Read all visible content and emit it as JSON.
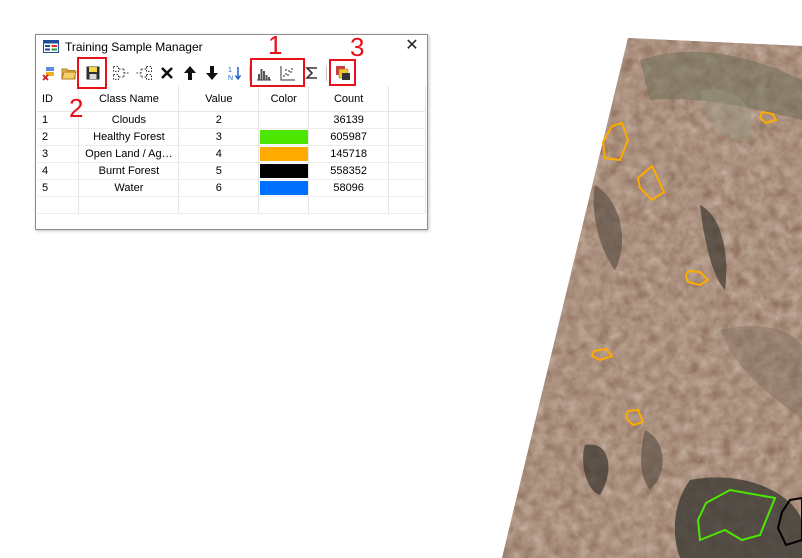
{
  "window": {
    "title": "Training Sample Manager",
    "close_glyph": "✕"
  },
  "toolbar": {
    "icons": [
      "remove-layer-icon",
      "open-folder-icon",
      "save-icon",
      "split-icon",
      "merge-icon",
      "delete-icon",
      "move-up-icon",
      "move-down-icon",
      "sort-icon",
      "histogram-icon",
      "scatterplot-icon",
      "statistics-sigma-icon",
      "evaluate-segmentation-icon"
    ]
  },
  "table": {
    "columns": [
      "ID",
      "Class Name",
      "Value",
      "Color",
      "Count"
    ],
    "rows": [
      {
        "id": "1",
        "class_name": "Clouds",
        "value": "2",
        "color": "#ffffff",
        "count": "36139"
      },
      {
        "id": "2",
        "class_name": "Healthy Forest",
        "value": "3",
        "color": "#4ce600",
        "count": "605987"
      },
      {
        "id": "3",
        "class_name": "Open Land / Ag…",
        "value": "4",
        "color": "#ffaa00",
        "count": "145718"
      },
      {
        "id": "4",
        "class_name": "Burnt Forest",
        "value": "5",
        "color": "#000000",
        "count": "558352"
      },
      {
        "id": "5",
        "class_name": "Water",
        "value": "6",
        "color": "#0070ff",
        "count": "58096"
      }
    ]
  },
  "annotations": {
    "label_1": "1",
    "label_2": "2",
    "label_3": "3",
    "color": "#e8101a"
  },
  "map": {
    "polygon_colors": {
      "open_land": "#ffaa00",
      "healthy_forest": "#4ce600",
      "burnt_forest": "#000000"
    }
  }
}
